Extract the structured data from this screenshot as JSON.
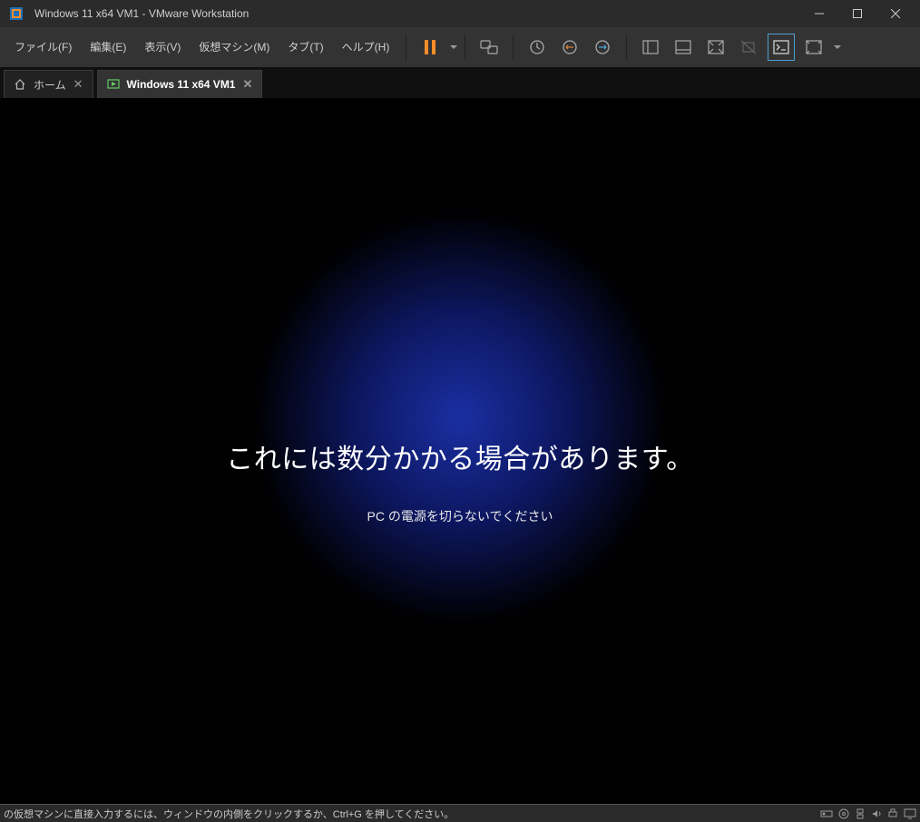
{
  "window": {
    "title": "Windows 11 x64 VM1 - VMware Workstation"
  },
  "menu": {
    "file": "ファイル(F)",
    "edit": "編集(E)",
    "view": "表示(V)",
    "vm": "仮想マシン(M)",
    "tabs": "タブ(T)",
    "help": "ヘルプ(H)"
  },
  "tabs": {
    "home": "ホーム",
    "vm1": "Windows 11 x64 VM1"
  },
  "guest_screen": {
    "main_text": "これには数分かかる場合があります。",
    "sub_text": "PC の電源を切らないでください"
  },
  "statusbar": {
    "hint": "の仮想マシンに直接入力するには、ウィンドウの内側をクリックするか、Ctrl+G を押してください。"
  }
}
